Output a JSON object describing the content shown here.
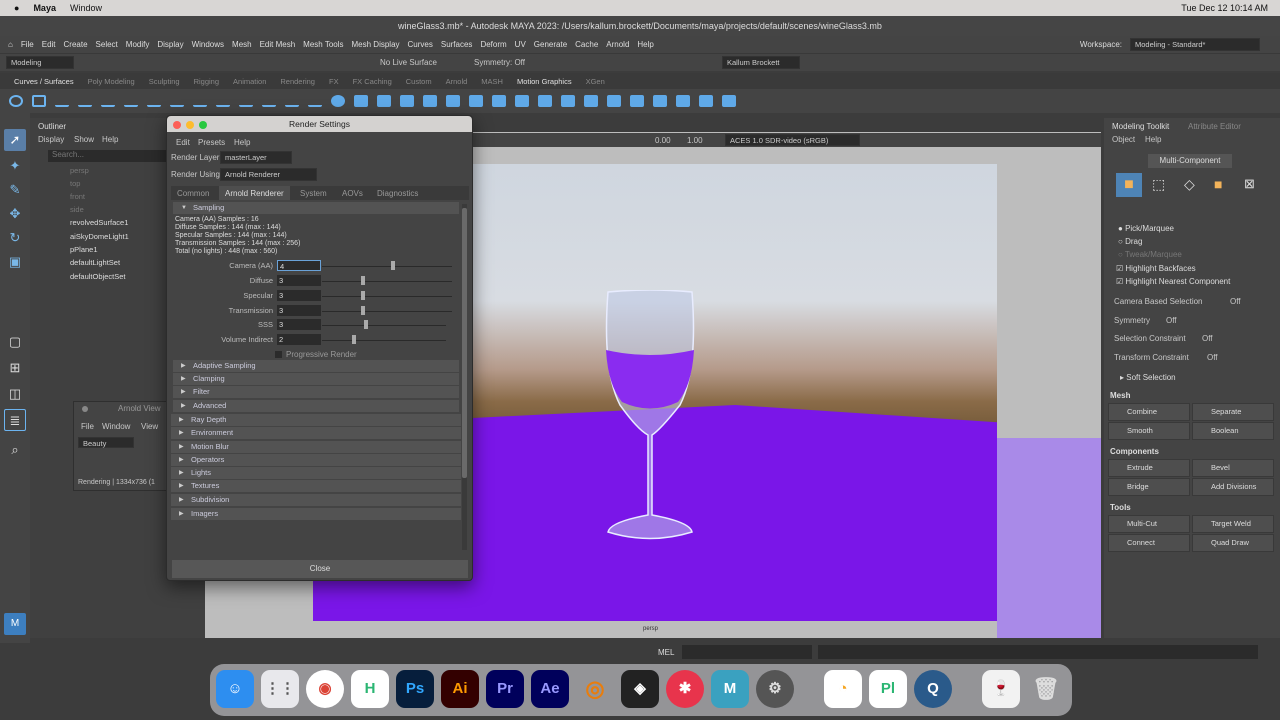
{
  "mac": {
    "app": "Maya",
    "menu": "Window",
    "clock": "Tue Dec 12  10:14 AM"
  },
  "window_title": "wineGlass3.mb* - Autodesk MAYA 2023: /Users/kallum.brockett/Documents/maya/projects/default/scenes/wineGlass3.mb",
  "menus": [
    "File",
    "Edit",
    "Create",
    "Select",
    "Modify",
    "Display",
    "Windows",
    "Mesh",
    "Edit Mesh",
    "Mesh Tools",
    "Mesh Display",
    "Curves",
    "Surfaces",
    "Deform",
    "UV",
    "Generate",
    "Cache",
    "Arnold",
    "Help"
  ],
  "workspace": {
    "label": "Workspace:",
    "value": "Modeling - Standard*"
  },
  "status": {
    "mode": "Modeling",
    "live": "No Live Surface",
    "symmetry": "Symmetry: Off",
    "user": "Kallum Brockett"
  },
  "shelf_tabs": [
    "Curves / Surfaces",
    "Poly Modeling",
    "Sculpting",
    "Rigging",
    "Animation",
    "Rendering",
    "FX",
    "FX Caching",
    "Custom",
    "Arnold",
    "MASH",
    "Motion Graphics",
    "XGen"
  ],
  "outliner": {
    "title": "Outliner",
    "menu": [
      "Display",
      "Show",
      "Help"
    ],
    "search": "Search...",
    "items": [
      "persp",
      "top",
      "front",
      "side",
      "revolvedSurface1",
      "aiSkyDomeLight1",
      "pPlane1",
      "defaultLightSet",
      "defaultObjectSet"
    ]
  },
  "viewport": {
    "val1": "0.00",
    "val2": "1.00",
    "colorspace": "ACES 1.0 SDR-video (sRGB)",
    "camera": "persp"
  },
  "render": {
    "title": "Render Settings",
    "menu": [
      "Edit",
      "Presets",
      "Help"
    ],
    "layer_label": "Render Layer",
    "layer": "masterLayer",
    "using_label": "Render Using",
    "using": "Arnold Renderer",
    "tabs": [
      "Common",
      "Arnold Renderer",
      "System",
      "AOVs",
      "Diagnostics"
    ],
    "sampling": "Sampling",
    "info": [
      "Camera (AA) Samples : 16",
      "Diffuse Samples : 144 (max : 144)",
      "Specular Samples : 144 (max : 144)",
      "Transmission Samples : 144 (max : 256)",
      "Total (no lights) : 448 (max : 560)"
    ],
    "params": [
      {
        "label": "Camera (AA)",
        "value": "4"
      },
      {
        "label": "Diffuse",
        "value": "3"
      },
      {
        "label": "Specular",
        "value": "3"
      },
      {
        "label": "Transmission",
        "value": "3"
      },
      {
        "label": "SSS",
        "value": "3"
      },
      {
        "label": "Volume Indirect",
        "value": "2"
      }
    ],
    "progressive": "Progressive Render",
    "sections": [
      "Adaptive Sampling",
      "Clamping",
      "Filter",
      "Advanced",
      "Ray Depth",
      "Environment",
      "Motion Blur",
      "Operators",
      "Lights",
      "Textures",
      "Subdivision",
      "Imagers"
    ],
    "close": "Close"
  },
  "arnold_view": {
    "title": "Arnold View",
    "menu": [
      "File",
      "Window",
      "View"
    ],
    "aov": "Beauty",
    "status": "Rendering | 1334x736 (1"
  },
  "toolkit": {
    "tabs": [
      "Modeling Toolkit",
      "Attribute Editor"
    ],
    "menu": [
      "Object",
      "Help"
    ],
    "mode": "Multi-Component",
    "pick": [
      "Pick/Marquee",
      "Drag",
      "Tweak/Marquee"
    ],
    "checks": [
      "Highlight Backfaces",
      "Highlight Nearest Component"
    ],
    "opts": [
      {
        "l": "Camera Based Selection",
        "v": "Off"
      },
      {
        "l": "Symmetry",
        "v": "Off"
      },
      {
        "l": "Selection Constraint",
        "v": "Off"
      },
      {
        "l": "Transform Constraint",
        "v": "Off"
      }
    ],
    "soft": "Soft Selection",
    "groups": [
      {
        "h": "Mesh",
        "b": [
          "Combine",
          "Separate",
          "Smooth",
          "Boolean"
        ]
      },
      {
        "h": "Components",
        "b": [
          "Extrude",
          "Bevel",
          "Bridge",
          "Add Divisions"
        ]
      },
      {
        "h": "Tools",
        "b": [
          "Multi-Cut",
          "Target Weld",
          "Connect",
          "Quad Draw"
        ]
      }
    ]
  },
  "cmd": "MEL",
  "dock": [
    "Ps",
    "Ai",
    "Pr",
    "Ae",
    "M",
    "Pl"
  ]
}
